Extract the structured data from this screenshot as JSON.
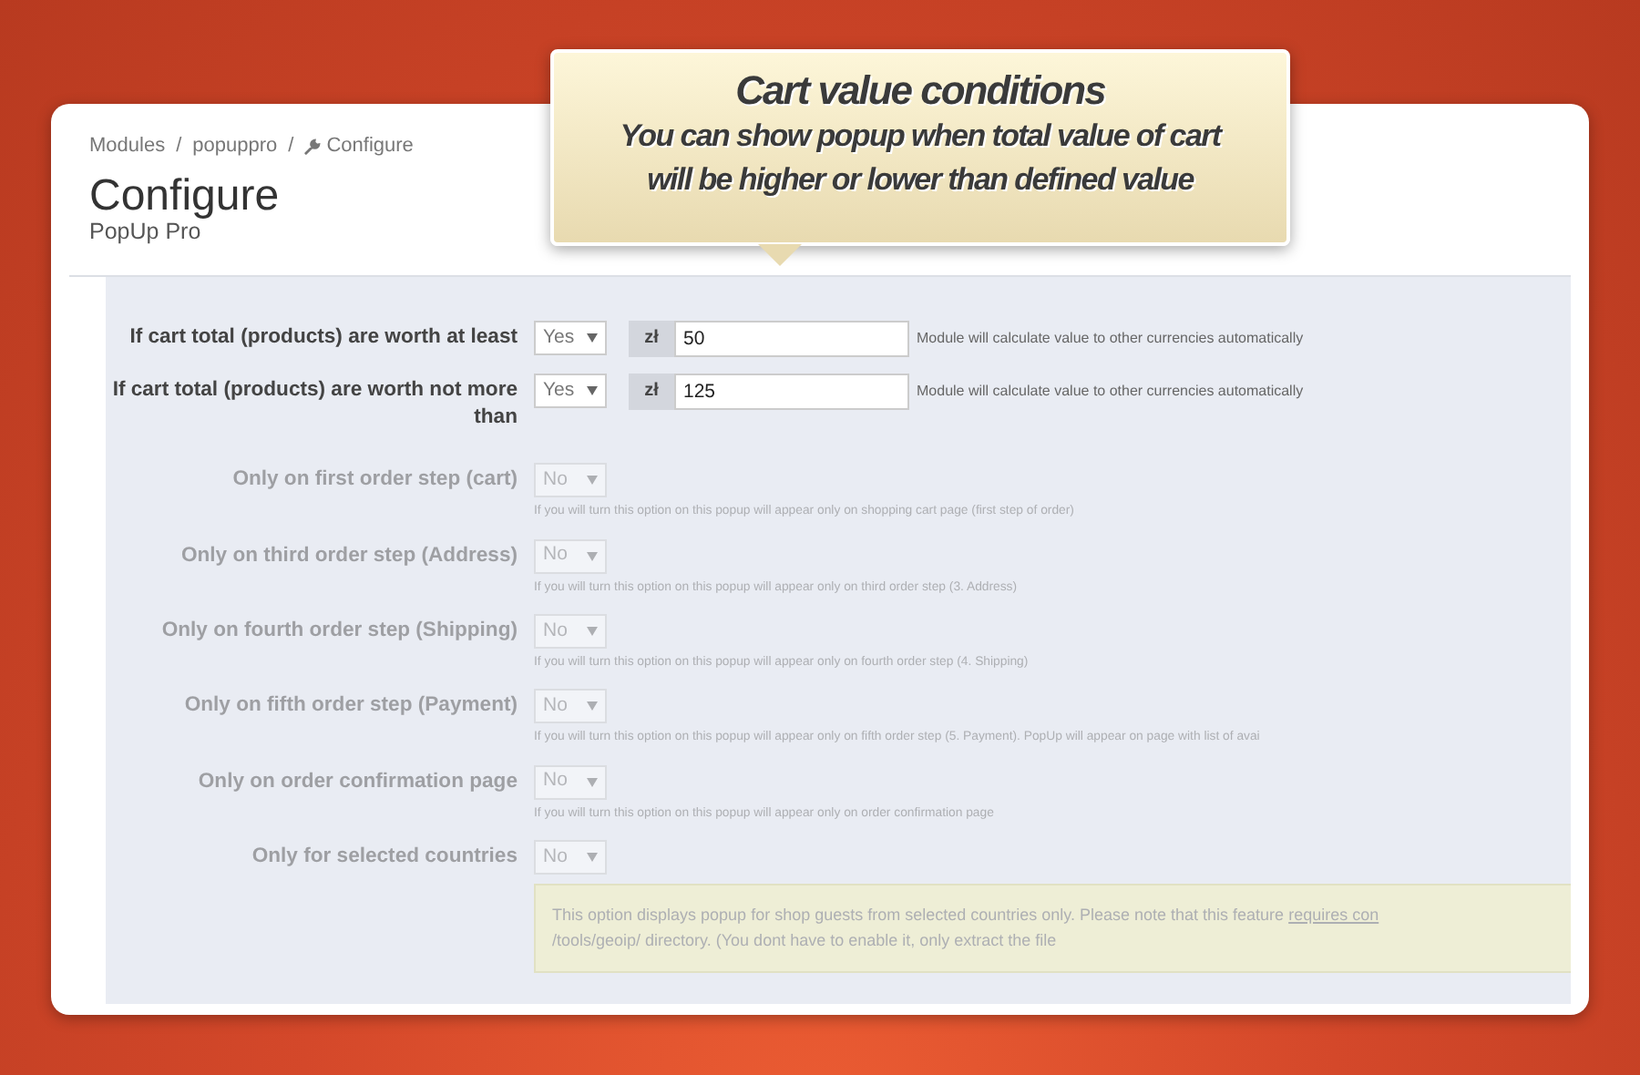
{
  "callout": {
    "title": "Cart value conditions",
    "text": "You can show popup when total value of cart will be higher or lower than defined value"
  },
  "breadcrumb": [
    {
      "kind": "link",
      "label": "Modules"
    },
    {
      "kind": "separator",
      "label": "/"
    },
    {
      "kind": "link",
      "label": "popuppro"
    },
    {
      "kind": "separator",
      "label": "/"
    },
    {
      "kind": "current",
      "label": "Configure"
    }
  ],
  "page_title": "Configure",
  "page_subtitle": "PopUp Pro",
  "form": {
    "rows": [
      {
        "kind": "amount",
        "label": "If cart total (products) are worth at least",
        "select": "Yes",
        "currency": "zł",
        "value": "50",
        "note": "Module will calculate value to other currencies automatically",
        "disabled": false
      },
      {
        "kind": "amount",
        "label": "If cart total (products) are worth not more than",
        "select": "Yes",
        "currency": "zł",
        "value": "125",
        "note": "Module will calculate value to other currencies automatically",
        "disabled": false
      },
      {
        "kind": "toggle",
        "label": "Only on first order step (cart)",
        "select": "No",
        "help": "If you will turn this option on this popup will appear only on shopping cart page (first step of order)",
        "disabled": true
      },
      {
        "kind": "toggle",
        "label": "Only on third order step (Address)",
        "select": "No",
        "help": "If you will turn this option on this popup will appear only on third order step (3. Address)",
        "disabled": true
      },
      {
        "kind": "toggle",
        "label": "Only on fourth order step (Shipping)",
        "select": "No",
        "help": "If you will turn this option on this popup will appear only on fourth order step (4. Shipping)",
        "disabled": true
      },
      {
        "kind": "toggle",
        "label": "Only on fifth order step (Payment)",
        "select": "No",
        "help": "If you will turn this option on this popup will appear only on fifth order step (5. Payment). PopUp will appear on page with list of avai",
        "disabled": true
      },
      {
        "kind": "toggle",
        "label": "Only on order confirmation page",
        "select": "No",
        "help": "If you will turn this option on this popup will appear only on order confirmation page",
        "disabled": true
      },
      {
        "kind": "alert",
        "label": "Only for selected countries",
        "select": "No",
        "alert": {
          "text": "This option displays popup for shop guests from selected countries only. Please note that this feature",
          "link": "requires con",
          "text2": "/tools/geoip/ directory. (You dont have to enable it, only extract the file"
        },
        "disabled": true
      }
    ]
  }
}
